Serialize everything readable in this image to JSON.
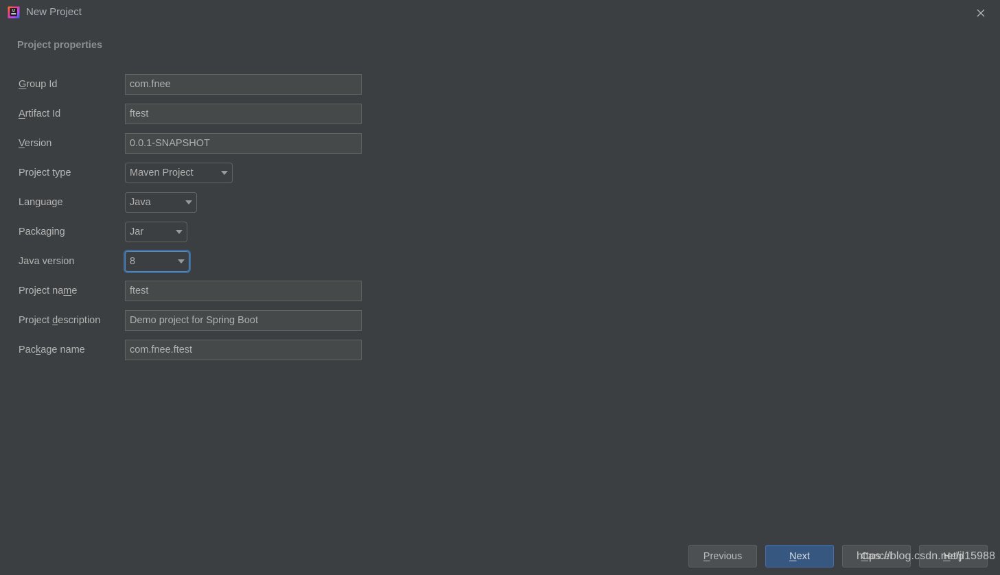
{
  "window": {
    "title": "New Project",
    "app_icon": "intellij-idea-logo-icon",
    "close_icon": "close-icon",
    "background_color": "#3c3f41"
  },
  "section": {
    "heading": "Project properties"
  },
  "form": {
    "fields": [
      {
        "label_pre": "",
        "label_mnemonic": "G",
        "label_post": "roup Id",
        "control": "text",
        "value": "com.fnee",
        "name": "group-id"
      },
      {
        "label_pre": "",
        "label_mnemonic": "A",
        "label_post": "rtifact Id",
        "control": "text",
        "value": "ftest",
        "name": "artifact-id"
      },
      {
        "label_pre": "",
        "label_mnemonic": "V",
        "label_post": "ersion",
        "control": "text",
        "value": "0.0.1-SNAPSHOT",
        "name": "version"
      },
      {
        "label_pre": "Project type",
        "label_mnemonic": "",
        "label_post": "",
        "control": "combo",
        "value": "Maven Project",
        "name": "project-type",
        "width_class": "w-project-type",
        "focused": false
      },
      {
        "label_pre": "Language",
        "label_mnemonic": "",
        "label_post": "",
        "control": "combo",
        "value": "Java",
        "name": "language",
        "width_class": "w-language",
        "focused": false
      },
      {
        "label_pre": "Packaging",
        "label_mnemonic": "",
        "label_post": "",
        "control": "combo",
        "value": "Jar",
        "name": "packaging",
        "width_class": "w-packaging",
        "focused": false
      },
      {
        "label_pre": "Java version",
        "label_mnemonic": "",
        "label_post": "",
        "control": "combo",
        "value": "8",
        "name": "java-version",
        "width_class": "w-javaversion",
        "focused": true
      },
      {
        "label_pre": "Project na",
        "label_mnemonic": "m",
        "label_post": "e",
        "control": "text",
        "value": "ftest",
        "name": "project-name"
      },
      {
        "label_pre": "Project ",
        "label_mnemonic": "d",
        "label_post": "escription",
        "control": "text",
        "value": "Demo project for Spring Boot",
        "name": "project-description"
      },
      {
        "label_pre": "Pac",
        "label_mnemonic": "k",
        "label_post": "age name",
        "control": "text",
        "value": "com.fnee.ftest",
        "name": "package-name"
      }
    ]
  },
  "buttons": {
    "previous": {
      "pre": "",
      "mnemonic": "P",
      "post": "revious",
      "primary": false
    },
    "next": {
      "pre": "",
      "mnemonic": "N",
      "post": "ext",
      "primary": true
    },
    "cancel": {
      "pre": "",
      "mnemonic": "C",
      "post": "ancel",
      "primary": false
    },
    "help": {
      "pre": "",
      "mnemonic": "H",
      "post": "elp",
      "primary": false
    }
  },
  "watermark": {
    "text": "https://blog.csdn.net/jl15988"
  },
  "colors": {
    "accent_blue": "#365880",
    "focus_ring": "#3d6d9e",
    "input_bg": "#45494a",
    "border": "#646464"
  }
}
